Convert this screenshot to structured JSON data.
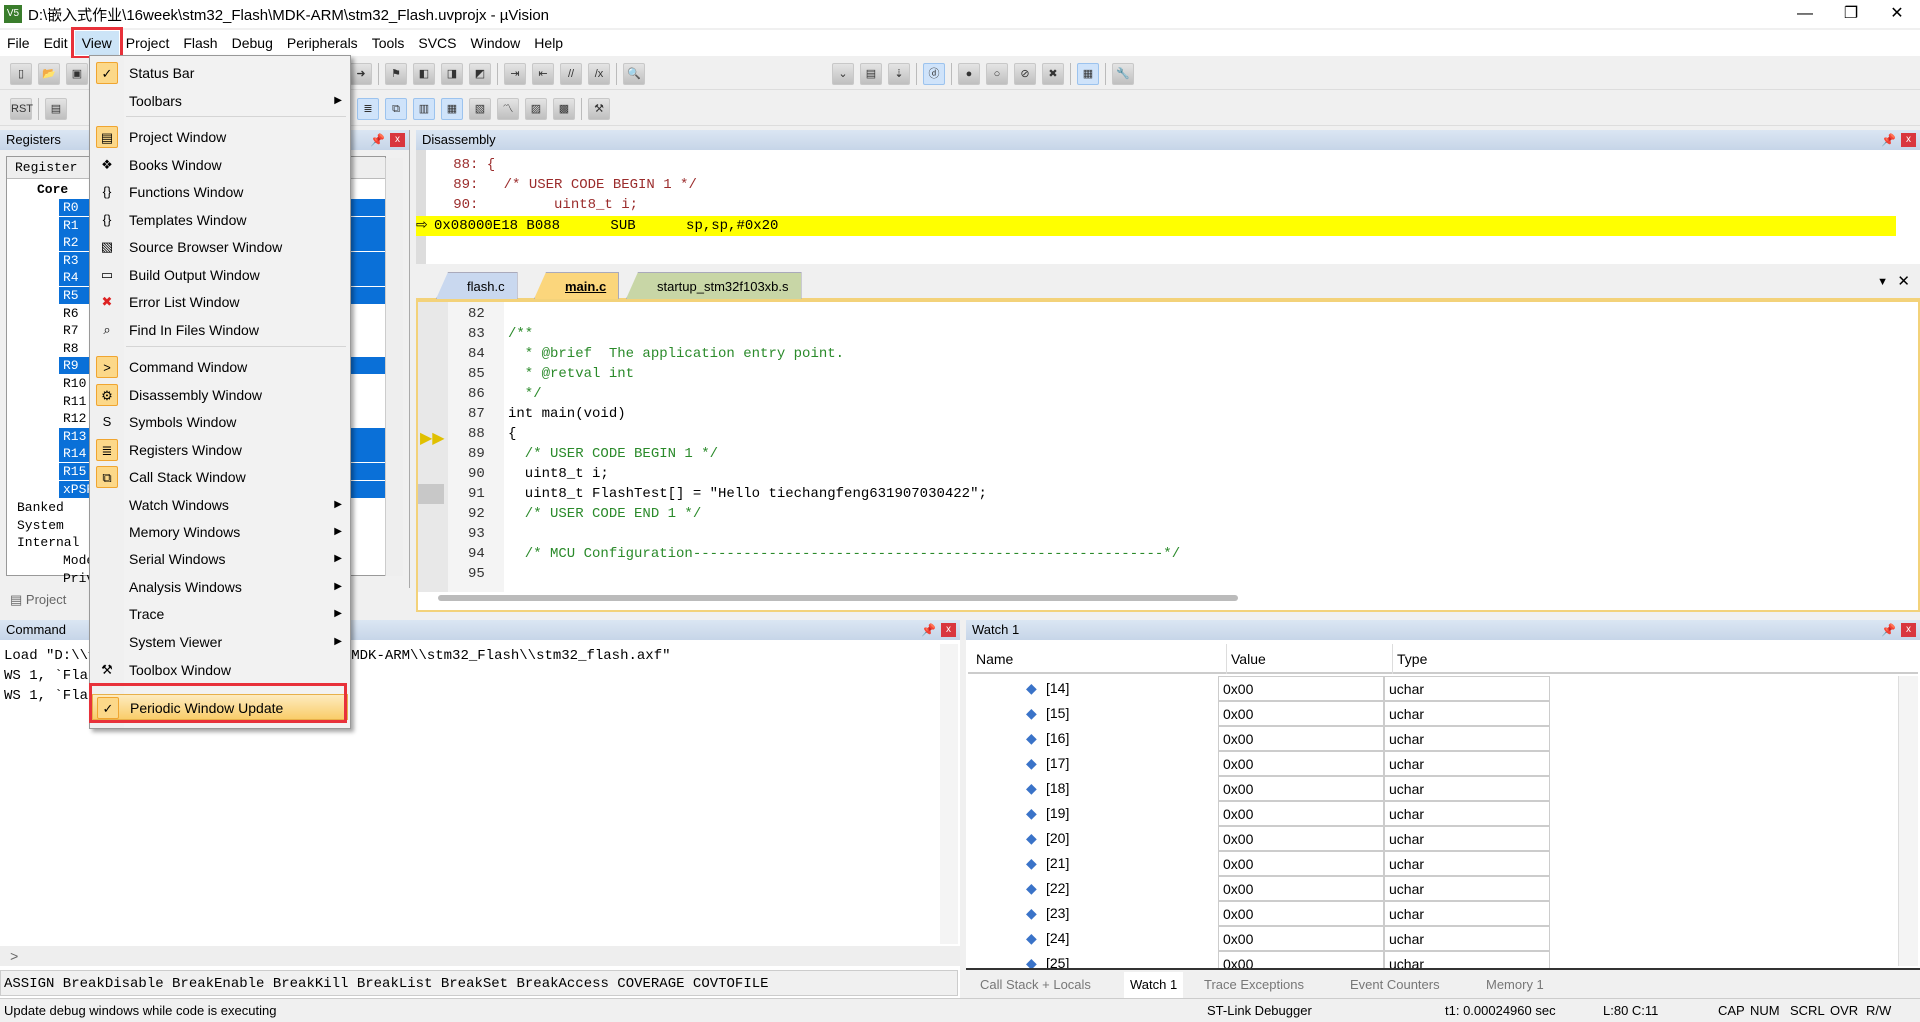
{
  "window": {
    "title": "D:\\嵌入式作业\\16week\\stm32_Flash\\MDK-ARM\\stm32_Flash.uvprojx - µVision",
    "logo": "V5"
  },
  "menubar": [
    "File",
    "Edit",
    "View",
    "Project",
    "Flash",
    "Debug",
    "Peripherals",
    "Tools",
    "SVCS",
    "Window",
    "Help"
  ],
  "view_menu": [
    {
      "label": "Status Bar",
      "icon": "check-icon",
      "checked": true
    },
    {
      "label": "Toolbars",
      "submenu": true
    },
    {
      "label": "Project Window",
      "icon": "project-window-icon"
    },
    {
      "label": "Books Window",
      "icon": "books-icon"
    },
    {
      "label": "Functions Window",
      "icon": "braces-icon"
    },
    {
      "label": "Templates Window",
      "icon": "templates-icon"
    },
    {
      "label": "Source Browser Window",
      "icon": "source-browser-icon"
    },
    {
      "label": "Build Output Window",
      "icon": "build-output-icon"
    },
    {
      "label": "Error List Window",
      "icon": "error-x-icon"
    },
    {
      "label": "Find In Files Window",
      "icon": "find-files-icon"
    },
    {
      "label": "Command Window",
      "icon": "command-icon"
    },
    {
      "label": "Disassembly Window",
      "icon": "disassembly-icon"
    },
    {
      "label": "Symbols Window",
      "icon": "symbols-icon"
    },
    {
      "label": "Registers Window",
      "icon": "registers-icon"
    },
    {
      "label": "Call Stack Window",
      "icon": "call-stack-icon"
    },
    {
      "label": "Watch Windows",
      "submenu": true
    },
    {
      "label": "Memory Windows",
      "submenu": true
    },
    {
      "label": "Serial Windows",
      "submenu": true
    },
    {
      "label": "Analysis Windows",
      "submenu": true
    },
    {
      "label": "Trace",
      "submenu": true
    },
    {
      "label": "System Viewer",
      "submenu": true
    },
    {
      "label": "Toolbox Window",
      "icon": "toolbox-icon"
    },
    {
      "label": "Periodic Window Update",
      "icon": "check-icon",
      "checked": true,
      "highlighted": true
    }
  ],
  "registers": {
    "title": "Registers",
    "column": "Register",
    "groups": [
      "Core",
      "Banked",
      "System",
      "Internal"
    ],
    "core": [
      "R0",
      "R1",
      "R2",
      "R3",
      "R4",
      "R5",
      "R6",
      "R7",
      "R8",
      "R9",
      "R10",
      "R11",
      "R12",
      "R13",
      "R14",
      "R15",
      "xPSR"
    ],
    "internal": [
      "Mode",
      "Priv"
    ],
    "tab": "Project"
  },
  "disassembly": {
    "title": "Disassembly",
    "lines": [
      "   88: {",
      "   89:   /* USER CODE BEGIN 1 */",
      "   90:         uint8_t i;"
    ],
    "current": "0x08000E18 B088      SUB      sp,sp,#0x20"
  },
  "editor": {
    "tabs": [
      "flash.c",
      "main.c",
      "startup_stm32f103xb.s"
    ],
    "active_tab": "main.c",
    "lines": [
      {
        "n": "82",
        "t": ""
      },
      {
        "n": "83",
        "t": "/**"
      },
      {
        "n": "84",
        "t": "  * @brief  The application entry point."
      },
      {
        "n": "85",
        "t": "  * @retval int"
      },
      {
        "n": "86",
        "t": "  */"
      },
      {
        "n": "87",
        "t": "int main(void)"
      },
      {
        "n": "88",
        "t": "{"
      },
      {
        "n": "89",
        "t": "  /* USER CODE BEGIN 1 */"
      },
      {
        "n": "90",
        "t": "  uint8_t i;"
      },
      {
        "n": "91",
        "t": "  uint8_t FlashTest[] = \"Hello tiechangfeng631907030422\";"
      },
      {
        "n": "92",
        "t": "  /* USER CODE END 1 */"
      },
      {
        "n": "93",
        "t": ""
      },
      {
        "n": "94",
        "t": "  /* MCU Configuration--------------------------------------------------------*/"
      },
      {
        "n": "95",
        "t": ""
      }
    ]
  },
  "command": {
    "title": "Command",
    "lines": [
      "Load \"D:\\\\嵌入式作业\\\\16week\\\\stm32_Flash\\\\MDK-ARM\\\\stm32_Flash\\\\stm32_flash.axf\"",
      "WS 1, `FlashTest",
      "WS 1, `FlashTest"
    ],
    "visible_tail": "_Flash\\\\MDK-ARM\\\\stm32_Flash\\\\stm32_flash.axf\"",
    "prompt": ">",
    "hints": "ASSIGN BreakDisable BreakEnable BreakKill BreakList BreakSet BreakAccess COVERAGE COVTOFILE"
  },
  "watch": {
    "title": "Watch 1",
    "columns": [
      "Name",
      "Value",
      "Type"
    ],
    "rows": [
      [
        "[14]",
        "0x00",
        "uchar"
      ],
      [
        "[15]",
        "0x00",
        "uchar"
      ],
      [
        "[16]",
        "0x00",
        "uchar"
      ],
      [
        "[17]",
        "0x00",
        "uchar"
      ],
      [
        "[18]",
        "0x00",
        "uchar"
      ],
      [
        "[19]",
        "0x00",
        "uchar"
      ],
      [
        "[20]",
        "0x00",
        "uchar"
      ],
      [
        "[21]",
        "0x00",
        "uchar"
      ],
      [
        "[22]",
        "0x00",
        "uchar"
      ],
      [
        "[23]",
        "0x00",
        "uchar"
      ],
      [
        "[24]",
        "0x00",
        "uchar"
      ],
      [
        "[25]",
        "0x00",
        "uchar"
      ]
    ],
    "tabs": [
      "Call Stack + Locals",
      "Watch 1",
      "Trace Exceptions",
      "Event Counters",
      "Memory 1"
    ],
    "active_tab": "Watch 1"
  },
  "status": {
    "message": "Update debug windows while code is executing",
    "debugger": "ST-Link Debugger",
    "time": "t1: 0.00024960 sec",
    "position": "L:80 C:11",
    "indicators": [
      "CAP",
      "NUM",
      "SCRL",
      "OVR",
      "R/W"
    ]
  },
  "colors": {
    "highlight_box": "#e8313a",
    "current_line": "#ffff00",
    "selection": "#0a70d8",
    "menu_highlight": "#f9cd6a"
  }
}
